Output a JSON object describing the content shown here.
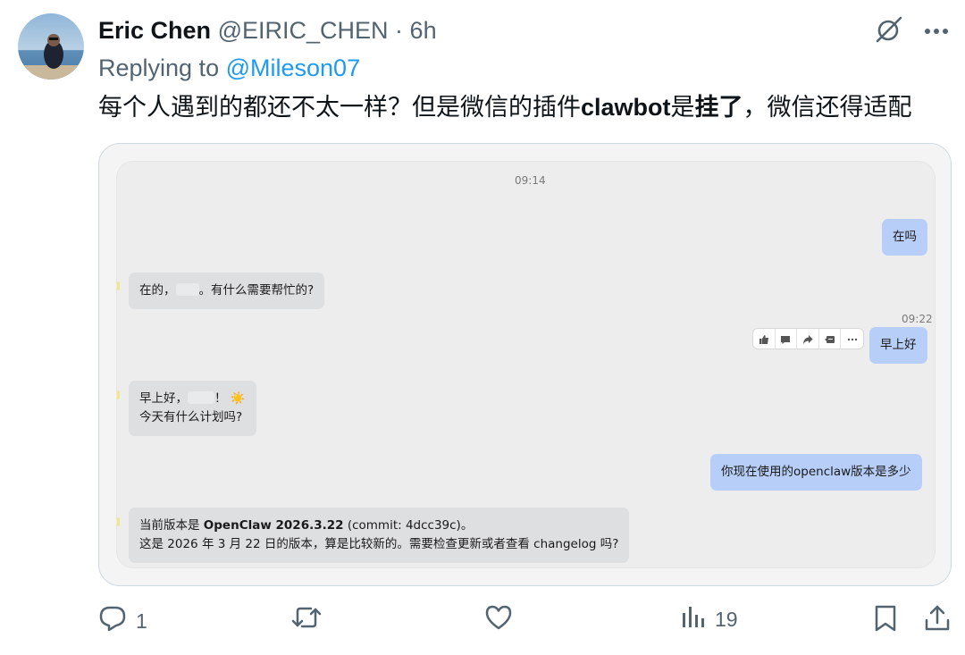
{
  "author": {
    "name": "Eric Chen",
    "handle": "@EIRIC_CHEN",
    "separator": "·",
    "time": "6h"
  },
  "reply": {
    "prefix": "Replying to",
    "mention": "@Mileson07"
  },
  "tweet": {
    "text_part1": "每个人遇到的都还不太一样？但是微信的插件",
    "text_bold1": "clawbot",
    "text_part2": "是",
    "text_bold2": "挂了",
    "text_part3": "，微信还得适配"
  },
  "chat": {
    "time1": "09:14",
    "msg1": "在吗",
    "msg2_a": "在的，",
    "msg2_b": "。有什么需要帮忙的?",
    "time2": "09:22",
    "msg3": "早上好",
    "msg4_line1_a": "早上好，",
    "msg4_line1_b": "！",
    "msg4_line1_c": "☀️",
    "msg4_line2": "今天有什么计划吗?",
    "msg5": "你现在使用的openclaw版本是多少",
    "msg6_line1_a": "当前版本是 ",
    "msg6_line1_bold": "OpenClaw 2026.3.22",
    "msg6_line1_b": " (commit: 4dcc39c)。",
    "msg6_line2": "这是 2026 年 3 月 22 日的版本，算是比较新的。需要检查更新或者查看 changelog 吗?"
  },
  "stats": {
    "replies": "1",
    "views": "19"
  },
  "colors": {
    "accent": "#1d9bf0",
    "muted": "#536471",
    "bubble_right": "#b7cff8",
    "bubble_left": "#dedfe1"
  },
  "icons": [
    "grok-icon",
    "more-icon",
    "thumbs-up-icon",
    "comment-icon",
    "forward-icon",
    "quote-icon",
    "ellipsis-icon",
    "reply-icon",
    "retweet-icon",
    "like-icon",
    "views-icon",
    "bookmark-icon",
    "share-icon"
  ]
}
